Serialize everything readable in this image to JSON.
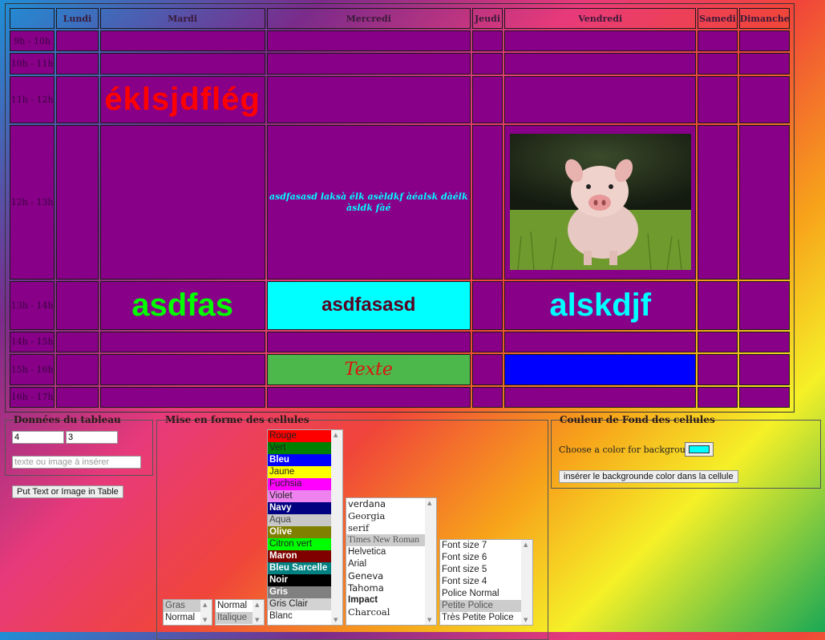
{
  "table": {
    "days": [
      "Lundi",
      "Mardi",
      "Mercredi",
      "Jeudi",
      "Vendredi",
      "Samedi",
      "Dimanche"
    ],
    "hours": [
      "9h - 10h",
      "10h - 11h",
      "11h - 12h",
      "12h - 13h",
      "13h - 14h",
      "14h - 15h",
      "15h - 16h",
      "16h - 17h"
    ],
    "cells": {
      "mardi_11h": "éklsjdflég",
      "mercredi_12h": "asdfasasd laksà élk asèldkf àéalsk dàélk àsldk fàé",
      "mardi_13h": "asdfas",
      "mercredi_13h": "asdfasasd",
      "vendredi_13h": "alskdjf",
      "mercredi_15h": "Texte"
    },
    "colors": {
      "cell_default": "#880088",
      "aqua": "#00ffff",
      "green": "#4cb84c",
      "blue": "#0000ff",
      "red_text": "#ff0000",
      "green_text": "#00ff00"
    },
    "image_icon": "piglet-photo"
  },
  "data_panel": {
    "legend": "Données du tableau",
    "row_value": "4",
    "col_value": "3",
    "content_placeholder": "texte ou image à insérer",
    "put_button": "Put Text or Image in Table"
  },
  "format_panel": {
    "legend": "Mise en forme des cellules",
    "weight_options": [
      {
        "label": "Gras",
        "selected": true
      },
      {
        "label": "Normal",
        "selected": false
      }
    ],
    "style_options": [
      {
        "label": "Normal",
        "selected": false
      },
      {
        "label": "Italique",
        "selected": true
      }
    ],
    "color_options": [
      {
        "label": "Rouge",
        "bg": "#ff0000",
        "fg": "#222222"
      },
      {
        "label": "Vert",
        "bg": "#008000",
        "fg": "#222222"
      },
      {
        "label": "Bleu",
        "bg": "#0000ff",
        "fg": "#ffffff"
      },
      {
        "label": "Jaune",
        "bg": "#ffff00",
        "fg": "#222222"
      },
      {
        "label": "Fuchsia",
        "bg": "#ff00ff",
        "fg": "#222222"
      },
      {
        "label": "Violet",
        "bg": "#ee82ee",
        "fg": "#222222"
      },
      {
        "label": "Navy",
        "bg": "#000080",
        "fg": "#ffffff"
      },
      {
        "label": "Aqua",
        "bg": "#c8c8c8",
        "fg": "#444444"
      },
      {
        "label": "Olive",
        "bg": "#808000",
        "fg": "#ffffff"
      },
      {
        "label": "Citron vert",
        "bg": "#00ff00",
        "fg": "#222222"
      },
      {
        "label": "Maron",
        "bg": "#800000",
        "fg": "#ffffff"
      },
      {
        "label": "Bleu Sarcelle",
        "bg": "#008080",
        "fg": "#ffffff"
      },
      {
        "label": "Noir",
        "bg": "#000000",
        "fg": "#ffffff"
      },
      {
        "label": "Gris",
        "bg": "#808080",
        "fg": "#ffffff"
      },
      {
        "label": "Gris Clair",
        "bg": "#d3d3d3",
        "fg": "#222222"
      },
      {
        "label": "Blanc",
        "bg": "#ffffff",
        "fg": "#222222"
      }
    ],
    "font_options": [
      {
        "label": "verdana",
        "family": "DejaVu Sans",
        "selected": false
      },
      {
        "label": "Georgia",
        "family": "DejaVu Serif",
        "selected": false
      },
      {
        "label": "serif",
        "family": "DejaVu Serif",
        "selected": false
      },
      {
        "label": "Times New Roman",
        "family": "Liberation Serif",
        "selected": true
      },
      {
        "label": "Helvetica",
        "family": "Liberation Sans",
        "selected": false
      },
      {
        "label": "Arial",
        "family": "Liberation Sans",
        "selected": false
      },
      {
        "label": "Geneva",
        "family": "DejaVu Sans",
        "selected": false
      },
      {
        "label": "Tahoma",
        "family": "DejaVu Sans",
        "selected": false
      },
      {
        "label": "Impact",
        "family": "Liberation Sans",
        "selected": false
      },
      {
        "label": "Charcoal",
        "family": "DejaVu Serif",
        "selected": false
      }
    ],
    "size_options": [
      {
        "label": "Font size 7",
        "selected": false
      },
      {
        "label": "Font size 6",
        "selected": false
      },
      {
        "label": "Font size 5",
        "selected": false
      },
      {
        "label": "Font size 4",
        "selected": false
      },
      {
        "label": "Police Normal",
        "selected": false
      },
      {
        "label": "Petite Police",
        "selected": true
      },
      {
        "label": "Très Petite Police",
        "selected": false
      }
    ]
  },
  "bg_panel": {
    "legend": "Couleur de Fond des cellules",
    "choose_label": "Choose a color for background:",
    "color_value": "#00ffff",
    "insert_button": "insérer le backgrounde color dans la cellule"
  }
}
